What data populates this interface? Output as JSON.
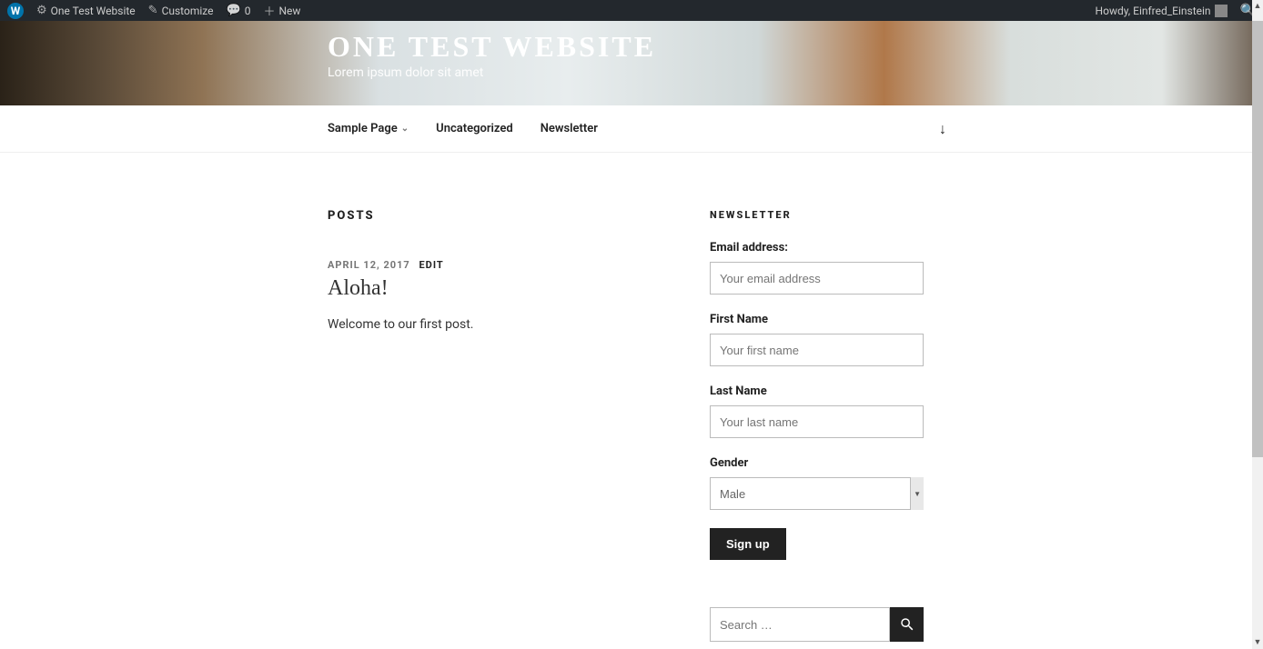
{
  "adminbar": {
    "site_name": "One Test Website",
    "customize": "Customize",
    "comments_count": "0",
    "new": "New",
    "howdy": "Howdy, Einfred_Einstein"
  },
  "hero": {
    "title": "ONE TEST WEBSITE",
    "tagline": "Lorem ipsum dolor sit amet"
  },
  "nav": {
    "items": [
      {
        "label": "Sample Page",
        "has_children": true
      },
      {
        "label": "Uncategorized",
        "has_children": false
      },
      {
        "label": "Newsletter",
        "has_children": false
      }
    ]
  },
  "posts": {
    "heading": "POSTS",
    "post": {
      "date": "APRIL 12, 2017",
      "edit": "EDIT",
      "title": "Aloha!",
      "excerpt": "Welcome to our first post."
    }
  },
  "sidebar": {
    "newsletter": {
      "title": "NEWSLETTER",
      "email_label": "Email address:",
      "email_placeholder": "Your email address",
      "first_label": "First Name",
      "first_placeholder": "Your first name",
      "last_label": "Last Name",
      "last_placeholder": "Your last name",
      "gender_label": "Gender",
      "gender_value": "Male",
      "submit": "Sign up"
    },
    "search": {
      "placeholder": "Search …"
    }
  }
}
